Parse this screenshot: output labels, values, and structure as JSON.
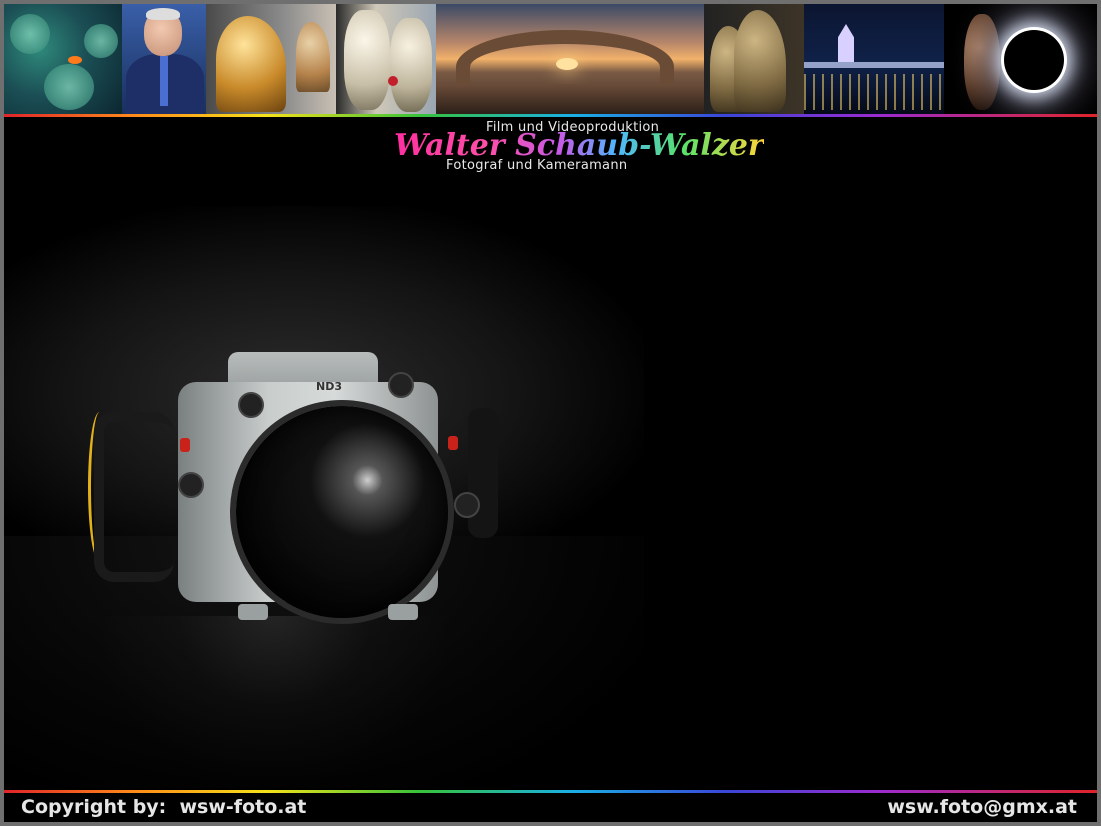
{
  "logo": {
    "line1": "Film und Videoproduktion",
    "name": "Walter Schaub-Walzer",
    "line3": "Fotograf und Kameramann"
  },
  "hero": {
    "camera_label": "ND3"
  },
  "footer": {
    "copyright": "Copyright by:  wsw-foto.at",
    "email": "wsw.foto@gmx.at"
  },
  "colors": {
    "background": "#000000",
    "frame": "#6f6f6f",
    "footer_text": "#e6e6e6",
    "strap": "#e3b21a"
  },
  "icons": {
    "banner": [
      "coral-reef-image",
      "portrait-image",
      "golden-horse-image",
      "venice-masks-image",
      "sunset-arch-image",
      "bronze-horses-image",
      "night-city-image",
      "solar-eclipse-image"
    ]
  }
}
